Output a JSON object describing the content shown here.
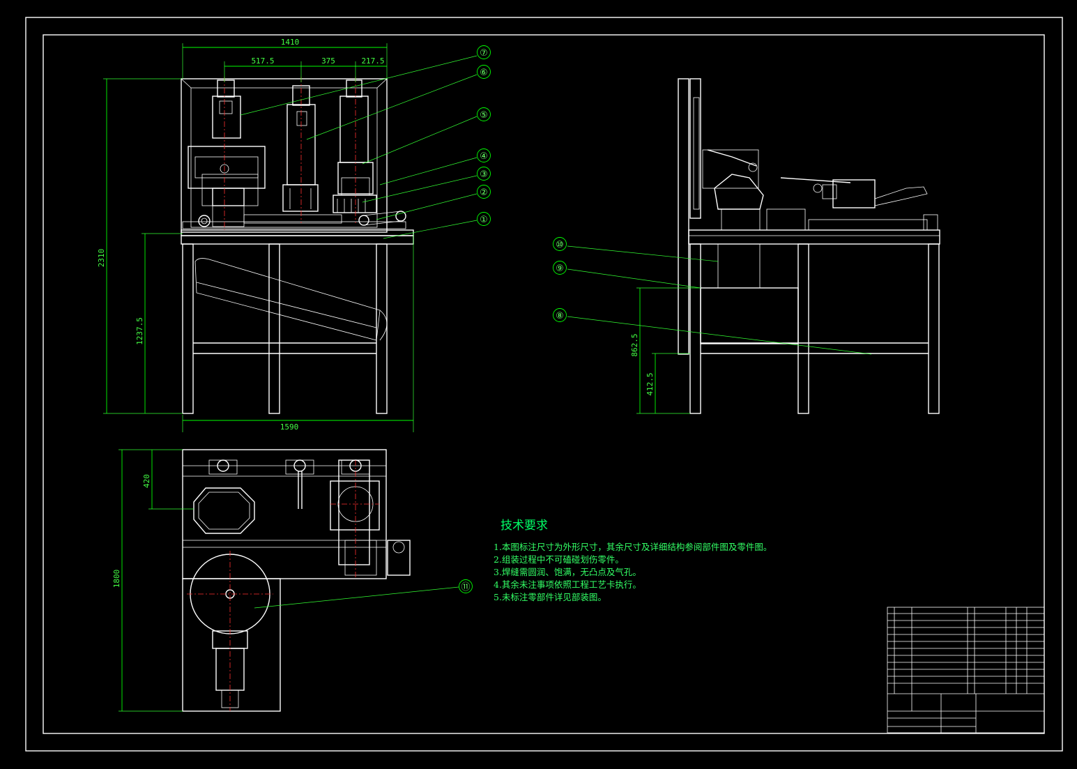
{
  "dimensions": {
    "overall_width": "1410",
    "seg_1": "517.5",
    "seg_2": "375",
    "seg_3": "217.5",
    "total_height": "2310",
    "table_height": "1237.5",
    "base_width": "1590",
    "plan_depth": "420",
    "plan_length": "1800",
    "side_height_1": "862.5",
    "side_height_2": "412.5"
  },
  "callouts": [
    "①",
    "②",
    "③",
    "④",
    "⑤",
    "⑥",
    "⑦",
    "⑧",
    "⑨",
    "⑩",
    "⑪"
  ],
  "requirements": {
    "title": "技术要求",
    "items": [
      "1.本图标注尺寸为外形尺寸，其余尺寸及详细结构参阅部件图及零件图。",
      "2.组装过程中不可磕碰划伤零件。",
      "3.焊缝需圆润、饱满，无凸点及气孔。",
      "4.其余未注事项依照工程工艺卡执行。",
      "5.未标注零部件详见部装图。"
    ]
  },
  "colors": {
    "background": "#000000",
    "outline": "#ffffff",
    "dimension": "#00ff00",
    "centerline": "#ff3030"
  }
}
